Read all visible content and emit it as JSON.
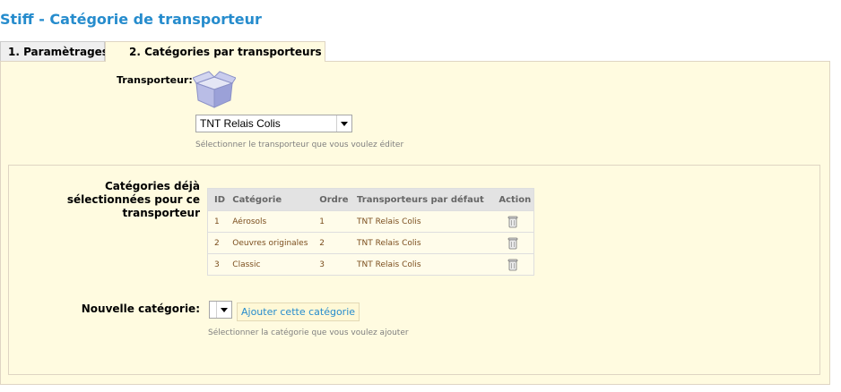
{
  "page": {
    "title": "Stiff - Catégorie de transporteur"
  },
  "tabs": [
    {
      "label": "1. Paramètrages"
    },
    {
      "label": "2. Catégories par transporteurs"
    }
  ],
  "carrier": {
    "label": "Transporteur:",
    "selected": "TNT Relais Colis",
    "hint": "Sélectionner le transporteur que vous voulez éditer"
  },
  "categories": {
    "label": "Catégories déjà sélectionnées pour ce transporteur",
    "headers": [
      "ID",
      "Catégorie",
      "Ordre",
      "Transporteurs par défaut",
      "Action"
    ],
    "rows": [
      {
        "id": "1",
        "category": "Aérosols",
        "order": "1",
        "default_carrier": "TNT Relais Colis"
      },
      {
        "id": "2",
        "category": "Oeuvres originales",
        "order": "2",
        "default_carrier": "TNT Relais Colis"
      },
      {
        "id": "3",
        "category": "Classic",
        "order": "3",
        "default_carrier": "TNT Relais Colis"
      }
    ]
  },
  "new_category": {
    "label": "Nouvelle catégorie:",
    "button": "Ajouter cette catégorie",
    "hint": "Sélectionner la catégorie que vous voulez ajouter"
  },
  "colors": {
    "title": "#268ccd",
    "panel_bg": "#fffbe0",
    "row_text": "#7b4e1e"
  },
  "icons": {
    "carrier": "box-icon",
    "delete": "trash-icon",
    "dropdown": "chevron-down-icon"
  }
}
